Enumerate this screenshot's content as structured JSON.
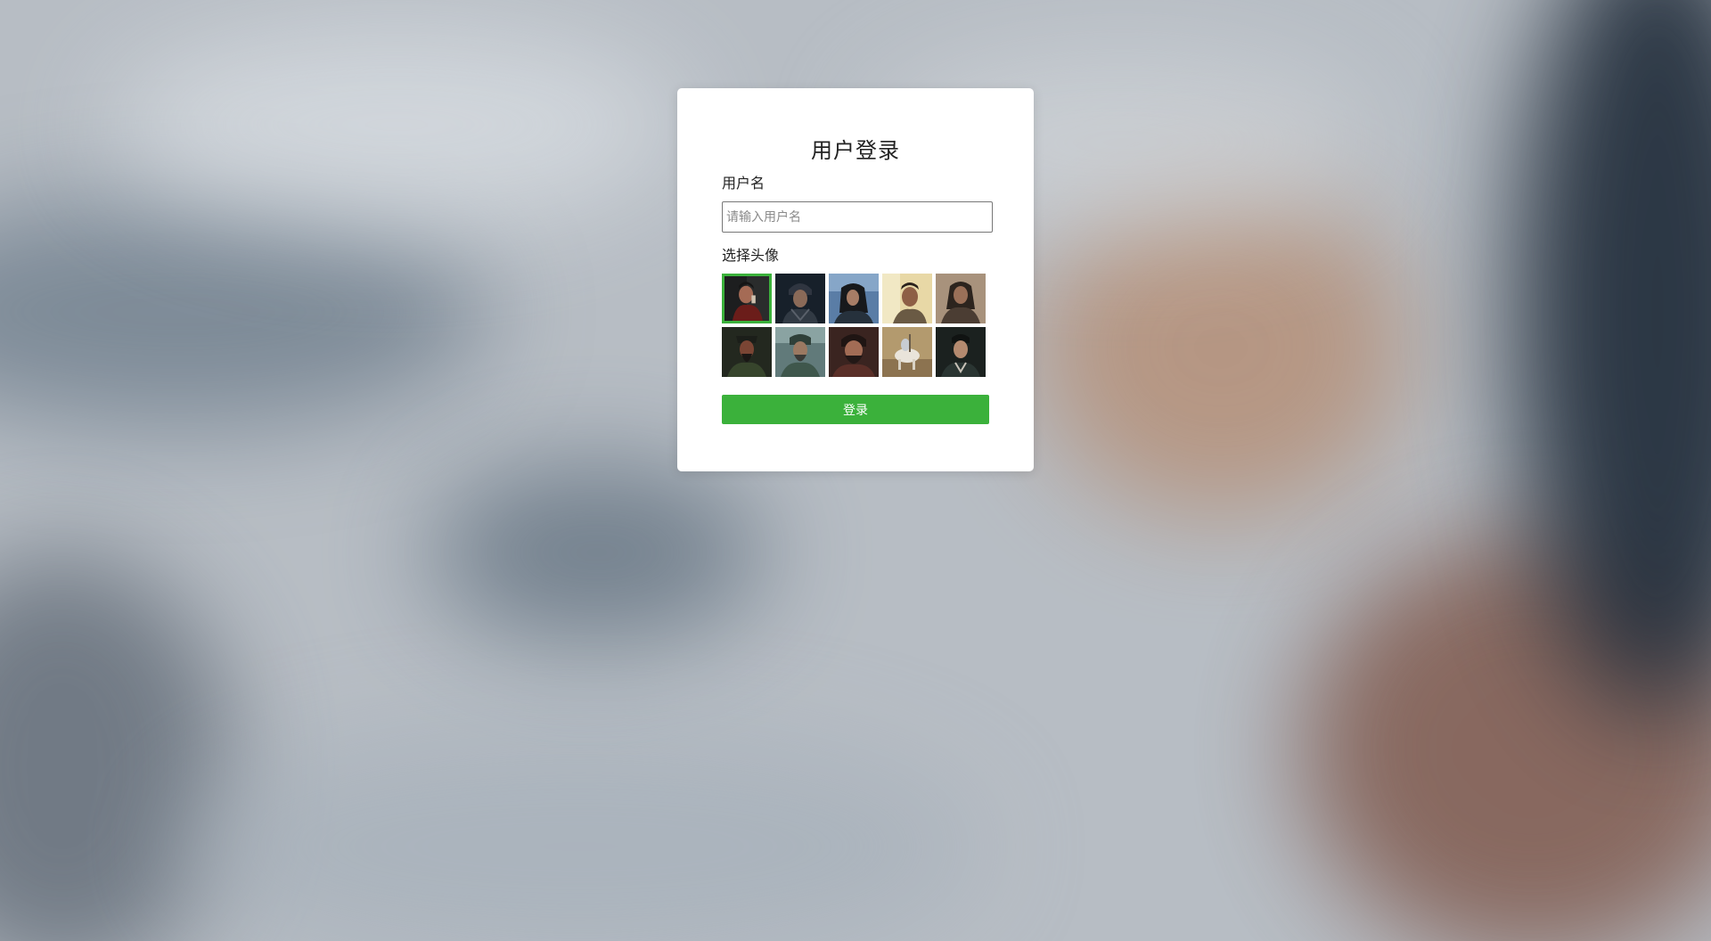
{
  "login": {
    "title": "用户登录",
    "username_label": "用户名",
    "username_placeholder": "请输入用户名",
    "username_value": "",
    "avatar_label": "选择头像",
    "submit_label": "登录"
  },
  "avatars": [
    {
      "selected": true
    },
    {
      "selected": false
    },
    {
      "selected": false
    },
    {
      "selected": false
    },
    {
      "selected": false
    },
    {
      "selected": false
    },
    {
      "selected": false
    },
    {
      "selected": false
    },
    {
      "selected": false
    },
    {
      "selected": false
    }
  ],
  "colors": {
    "accent": "#3bb13b",
    "card_background": "#ffffff",
    "page_background": "#b7bdc4"
  }
}
